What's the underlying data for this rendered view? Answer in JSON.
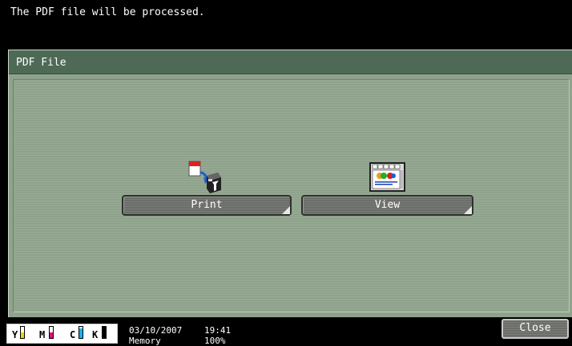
{
  "message_bar": {
    "text": "The PDF file will be processed."
  },
  "panel": {
    "title": "PDF File"
  },
  "actions": {
    "print_label": "Print",
    "view_label": "View"
  },
  "icons": {
    "print": "print-document-icon",
    "view": "view-document-icon"
  },
  "status": {
    "date": "03/10/2007",
    "time": "19:41",
    "memory_label": "Memory",
    "memory_value": "100%",
    "toner": [
      {
        "label": "Y",
        "color": "#e8d800",
        "level": 0.5
      },
      {
        "label": "M",
        "color": "#e0107c",
        "level": 0.5
      },
      {
        "label": "C",
        "color": "#1ab0e8",
        "level": 0.85
      },
      {
        "label": "K",
        "color": "#000000",
        "level": 1.0
      }
    ]
  },
  "footer": {
    "close_label": "Close"
  },
  "colors": {
    "panel_bg": "#8fa38c",
    "panel_title_bg": "#4e6a57",
    "button_bg": "#6b6d69"
  }
}
